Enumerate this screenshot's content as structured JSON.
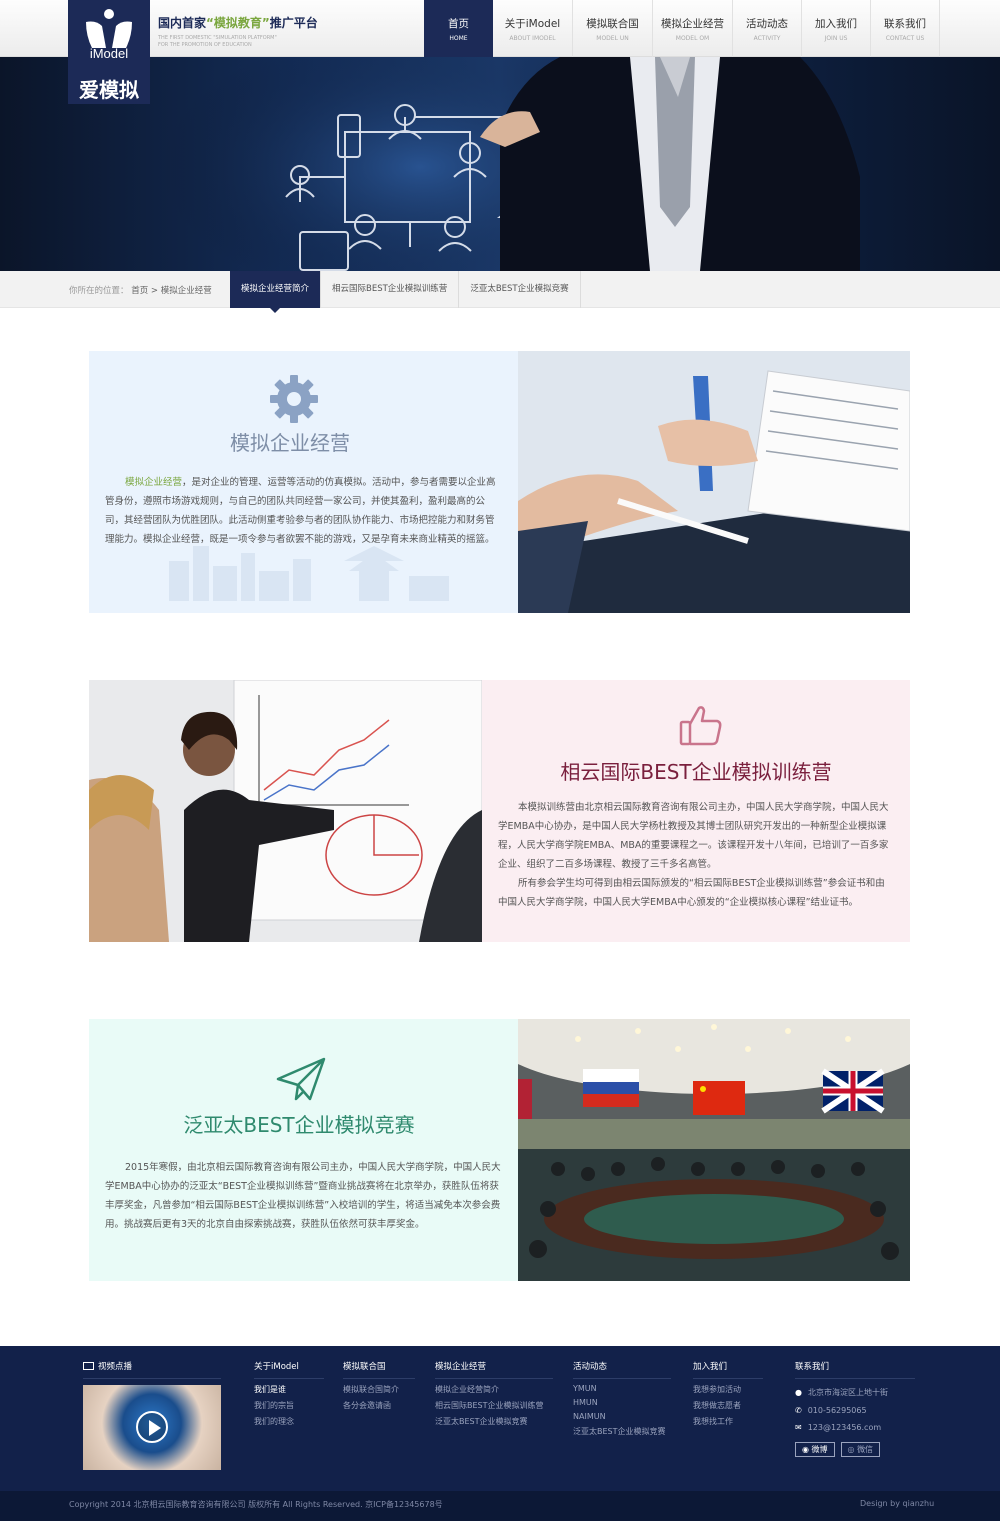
{
  "header": {
    "logo_brand": "iModel",
    "logo_cn": "爱模拟",
    "slogan_pre": "国内首家",
    "slogan_highlight": "“模拟教育”",
    "slogan_post": "推广平台",
    "slogan_en1": "THE FIRST DOMESTIC \"SIMULATION PLATFORM\"",
    "slogan_en2": "FOR THE PROMOTION OF EDUCATION",
    "nav": [
      {
        "cn": "首页",
        "en": "HOME"
      },
      {
        "cn": "关于iModel",
        "en": "ABOUT IMODEL"
      },
      {
        "cn": "模拟联合国",
        "en": "MODEL UN"
      },
      {
        "cn": "模拟企业经营",
        "en": "MODEL OM"
      },
      {
        "cn": "活动动态",
        "en": "ACTIVITY"
      },
      {
        "cn": "加入我们",
        "en": "JOIN US"
      },
      {
        "cn": "联系我们",
        "en": "CONTACT US"
      }
    ]
  },
  "breadcrumb": {
    "prefix": "你所在的位置：",
    "path": "首页 > 模拟企业经营",
    "tabs": [
      "模拟企业经营简介",
      "相云国际BEST企业模拟训练营",
      "泛亚太BEST企业模拟竞赛"
    ]
  },
  "sections": [
    {
      "title": "模拟企业经营",
      "lead": "模拟企业经营",
      "body": "，是对企业的管理、运营等活动的仿真模拟。活动中，参与者需要以企业高管身份，遵照市场游戏规则，与自己的团队共同经营一家公司，并使其盈利，盈利最高的公司，其经营团队为优胜团队。此活动侧重考验参与者的团队协作能力、市场把控能力和财务管理能力。模拟企业经营，既是一项令参与者欲罢不能的游戏，又是孕育未来商业精英的摇篮。"
    },
    {
      "title": "相云国际BEST企业模拟训练营",
      "body1": "本模拟训练营由北京相云国际教育咨询有限公司主办，中国人民大学商学院，中国人民大学EMBA中心协办，是中国人民大学杨杜教授及其博士团队研究开发出的一种新型企业模拟课程，人民大学商学院EMBA、MBA的重要课程之一。该课程开发十八年间，已培训了一百多家企业、组织了二百多场课程、教授了三千多名高管。",
      "body2": "所有参会学生均可得到由相云国际颁发的“相云国际BEST企业模拟训练营”参会证书和由中国人民大学商学院，中国人民大学EMBA中心颁发的“企业模拟核心课程”结业证书。"
    },
    {
      "title": "泛亚太BEST企业模拟竞赛",
      "body": "2015年寒假，由北京相云国际教育咨询有限公司主办，中国人民大学商学院，中国人民大学EMBA中心协办的泛亚太“BEST企业模拟训练营”暨商业挑战赛将在北京举办，获胜队伍将获丰厚奖金，凡曾参加“相云国际BEST企业模拟训练营”入校培训的学生，将适当减免本次参会费用。挑战赛后更有3天的北京自由探索挑战赛，获胜队伍依然可获丰厚奖金。"
    }
  ],
  "footer": {
    "video_title": "视频点播",
    "cols": [
      {
        "h": "关于iModel",
        "items": [
          "我们是谁",
          "我们的宗旨",
          "我们的理念"
        ]
      },
      {
        "h": "模拟联合国",
        "items": [
          "模拟联合国简介",
          "各分会邀请函"
        ]
      },
      {
        "h": "模拟企业经营",
        "items": [
          "模拟企业经营简介",
          "相云国际BEST企业模拟训练营",
          "泛亚太BEST企业模拟竞赛"
        ]
      },
      {
        "h": "活动动态",
        "items": [
          "YMUN",
          "HMUN",
          "NAIMUN",
          "泛亚太BEST企业模拟竞赛"
        ]
      },
      {
        "h": "加入我们",
        "items": [
          "我想参加活动",
          "我想做志愿者",
          "我想找工作"
        ]
      }
    ],
    "contact_h": "联系我们",
    "address": "北京市海淀区上地十街",
    "phone": "010-56295065",
    "email": "123@123456.com",
    "weibo": "微博",
    "weixin": "微信",
    "copyright": "Copyright 2014 北京相云国际教育咨询有限公司 版权所有 All Rights Reserved.   京ICP备12345678号",
    "design": "Design by qianzhu"
  },
  "colors": {
    "navy": "#1c2a57",
    "green": "#7aa63e",
    "teal": "#2f8a6e",
    "maroon": "#7a1f3d"
  }
}
